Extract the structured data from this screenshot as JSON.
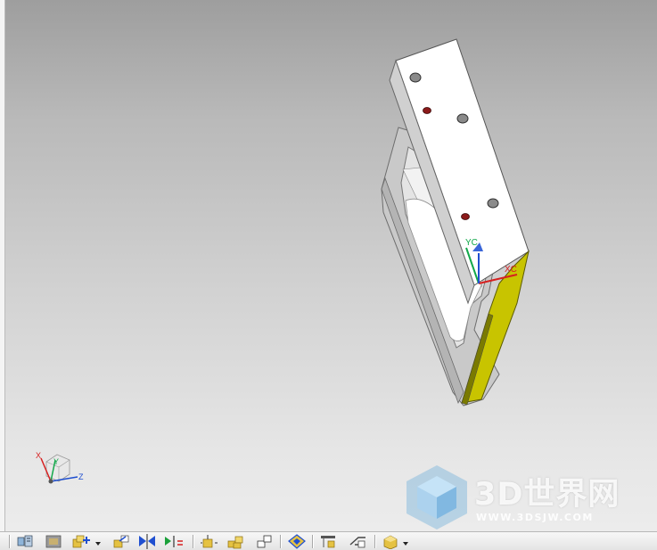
{
  "viewport": {
    "background_top": "#9e9e9e",
    "background_bottom": "#ececec"
  },
  "part": {
    "face_color": "#ffffff",
    "side_color": "#c8c8c8",
    "selected_face_color": "#c8c400",
    "hole_color": "#8a8a8a",
    "red_hole_color": "#8b1a1a"
  },
  "wcs_labels": {
    "yc": "YC",
    "xc": "XC"
  },
  "triad_labels": {
    "x": "X",
    "y": "Y",
    "z": "Z"
  },
  "watermark": {
    "title": "3D世界网",
    "url": "WWW.3DSJW.COM"
  },
  "toolbar_icons": [
    "assembly-navigator-icon",
    "component-icon",
    "add-component-icon",
    "move-component-icon",
    "mirror-assembly-icon",
    "assembly-constraints-icon",
    "exploded-view-icon",
    "wave-geometry-icon",
    "reposition-icon",
    "check-clearance-icon",
    "sequence-icon",
    "assembly-cut-icon",
    "display-part-icon"
  ]
}
